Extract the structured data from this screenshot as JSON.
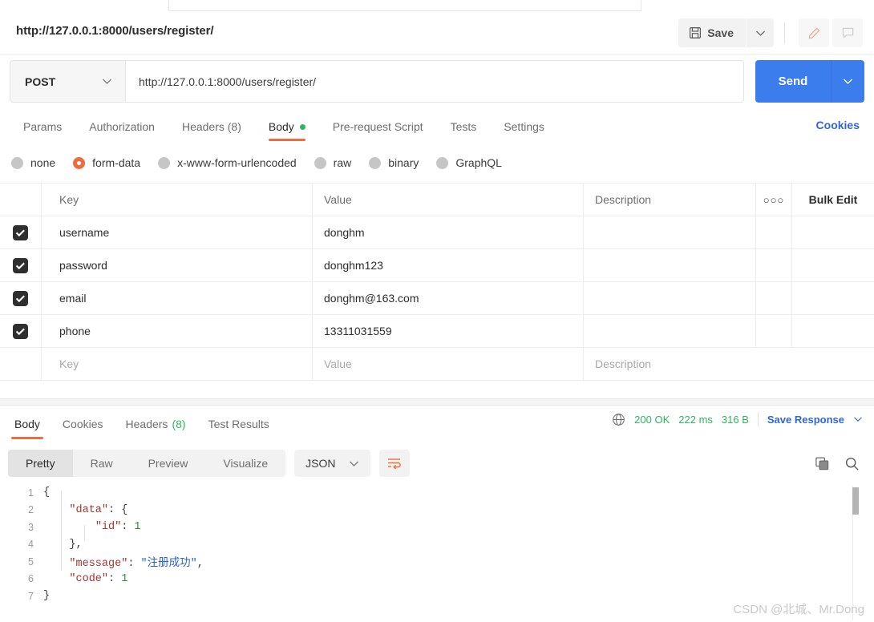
{
  "request": {
    "title": "http://127.0.0.1:8000/users/register/",
    "method": "POST",
    "url": "http://127.0.0.1:8000/users/register/",
    "save_label": "Save",
    "send_label": "Send"
  },
  "req_tabs": [
    {
      "label": "Params",
      "active": false
    },
    {
      "label": "Authorization",
      "active": false
    },
    {
      "label": "Headers (8)",
      "active": false
    },
    {
      "label": "Body",
      "active": true,
      "dot": true
    },
    {
      "label": "Pre-request Script",
      "active": false
    },
    {
      "label": "Tests",
      "active": false
    },
    {
      "label": "Settings",
      "active": false
    }
  ],
  "cookies_link": "Cookies",
  "body_types": [
    {
      "label": "none",
      "selected": false
    },
    {
      "label": "form-data",
      "selected": true
    },
    {
      "label": "x-www-form-urlencoded",
      "selected": false
    },
    {
      "label": "raw",
      "selected": false
    },
    {
      "label": "binary",
      "selected": false
    },
    {
      "label": "GraphQL",
      "selected": false
    }
  ],
  "table": {
    "headers": {
      "key": "Key",
      "value": "Value",
      "description": "Description"
    },
    "dots_icon": "more-options-icon",
    "bulk_edit": "Bulk Edit",
    "rows": [
      {
        "checked": true,
        "key": "username",
        "value": "donghm",
        "description": ""
      },
      {
        "checked": true,
        "key": "password",
        "value": "donghm123",
        "description": ""
      },
      {
        "checked": true,
        "key": "email",
        "value": "donghm@163.com",
        "description": ""
      },
      {
        "checked": true,
        "key": "phone",
        "value": "13311031559",
        "description": ""
      }
    ],
    "placeholder_row": {
      "key": "Key",
      "value": "Value",
      "description": "Description"
    }
  },
  "response": {
    "tabs": [
      {
        "label": "Body",
        "active": true
      },
      {
        "label": "Cookies",
        "active": false
      },
      {
        "label": "Headers",
        "count": "(8)",
        "active": false
      },
      {
        "label": "Test Results",
        "active": false
      }
    ],
    "status": "200 OK",
    "time": "222 ms",
    "size": "316 B",
    "save_response": "Save Response",
    "view_modes": [
      {
        "label": "Pretty",
        "active": true
      },
      {
        "label": "Raw",
        "active": false
      },
      {
        "label": "Preview",
        "active": false
      },
      {
        "label": "Visualize",
        "active": false
      }
    ],
    "format": "JSON",
    "body_lines": [
      {
        "n": "1",
        "parts": [
          {
            "t": "p",
            "v": "{"
          }
        ]
      },
      {
        "n": "2",
        "parts": [
          {
            "t": "p",
            "v": "    "
          },
          {
            "t": "k",
            "v": "\"data\""
          },
          {
            "t": "p",
            "v": ": {"
          }
        ]
      },
      {
        "n": "3",
        "parts": [
          {
            "t": "p",
            "v": "        "
          },
          {
            "t": "k",
            "v": "\"id\""
          },
          {
            "t": "p",
            "v": ": "
          },
          {
            "t": "n",
            "v": "1"
          }
        ]
      },
      {
        "n": "4",
        "parts": [
          {
            "t": "p",
            "v": "    },"
          }
        ]
      },
      {
        "n": "5",
        "parts": [
          {
            "t": "p",
            "v": "    "
          },
          {
            "t": "k",
            "v": "\"message\""
          },
          {
            "t": "p",
            "v": ": "
          },
          {
            "t": "s",
            "v": "\"注册成功\""
          },
          {
            "t": "p",
            "v": ","
          }
        ]
      },
      {
        "n": "6",
        "parts": [
          {
            "t": "p",
            "v": "    "
          },
          {
            "t": "k",
            "v": "\"code\""
          },
          {
            "t": "p",
            "v": ": "
          },
          {
            "t": "n",
            "v": "1"
          }
        ]
      },
      {
        "n": "7",
        "parts": [
          {
            "t": "p",
            "v": "}"
          }
        ]
      }
    ]
  },
  "watermark": "CSDN @北城、Mr.Dong",
  "colors": {
    "accent_orange": "#ef6c3e",
    "send_blue": "#3b7ded",
    "link_blue": "#2f66de",
    "status_green": "#2eb561"
  }
}
